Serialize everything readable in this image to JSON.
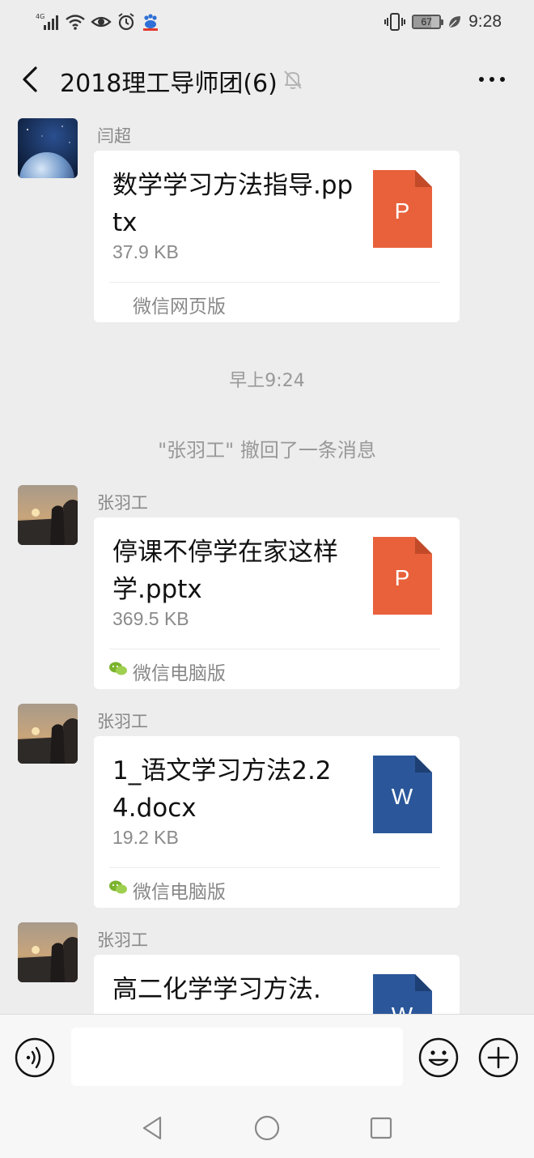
{
  "status_bar": {
    "network": "4G",
    "battery": "67",
    "battery_level": 0.67,
    "time": "9:28"
  },
  "header": {
    "title": "2018理工导师团(6)",
    "back_icon": "chevron-left-icon",
    "mute_icon": "bell-off-icon",
    "more_icon": "more-dots-icon"
  },
  "chat": {
    "messages": [
      {
        "sender": "闫超",
        "file_name": "数学学习方法指导.pptx",
        "file_size": "37.9 KB",
        "file_type": "P",
        "file_color": "#e8613b",
        "source": "微信网页版"
      },
      {
        "sender": "张羽工",
        "file_name": "停课不停学在家这样学.pptx",
        "file_size": "369.5 KB",
        "file_type": "P",
        "file_color": "#e8613b",
        "source": "微信电脑版"
      },
      {
        "sender": "张羽工",
        "file_name": "1_语文学习方法2.24.docx",
        "file_size": "19.2 KB",
        "file_type": "W",
        "file_color": "#2b579a",
        "source": "微信电脑版"
      },
      {
        "sender": "张羽工",
        "file_name": "高二化学学习方法.",
        "file_type": "W",
        "file_color": "#2b579a"
      }
    ],
    "time_label": "早上9:24",
    "recall_notice": "\"张羽工\" 撤回了一条消息"
  },
  "input_bar": {
    "voice_icon": "voice-icon",
    "text_value": "",
    "emoji_icon": "emoji-icon",
    "plus_icon": "plus-icon"
  },
  "nav_bar": {
    "back_icon": "triangle-back-icon",
    "home_icon": "circle-home-icon",
    "recent_icon": "square-recent-icon"
  },
  "colors": {
    "background": "#ededed",
    "bubble": "#ffffff",
    "pptx": "#e8613b",
    "docx": "#2b579a",
    "wechat_green": "#7bb32e"
  }
}
